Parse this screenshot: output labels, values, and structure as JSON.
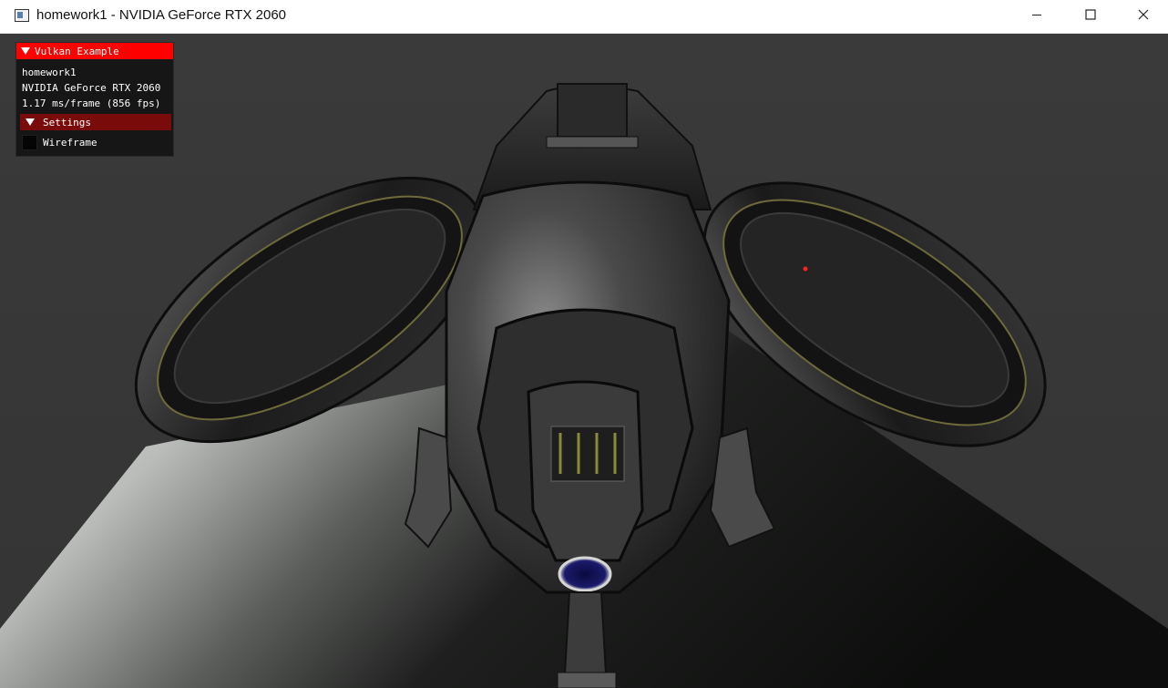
{
  "window": {
    "title": "homework1 - NVIDIA GeForce RTX 2060",
    "icon": "app-window-icon",
    "controls": {
      "minimize_icon": "minimize-icon",
      "maximize_icon": "maximize-icon",
      "close_icon": "close-icon"
    }
  },
  "overlay": {
    "header": "Vulkan Example",
    "app_name": "homework1",
    "gpu": "NVIDIA GeForce RTX 2060",
    "frame_stats": "1.17 ms/frame (856 fps)",
    "settings_header": "Settings",
    "wireframe_label": "Wireframe",
    "wireframe_checked": false
  },
  "colors": {
    "overlay_header": "#ff0000",
    "settings_header": "#7a0b0b",
    "background": "#3a3a3a"
  }
}
